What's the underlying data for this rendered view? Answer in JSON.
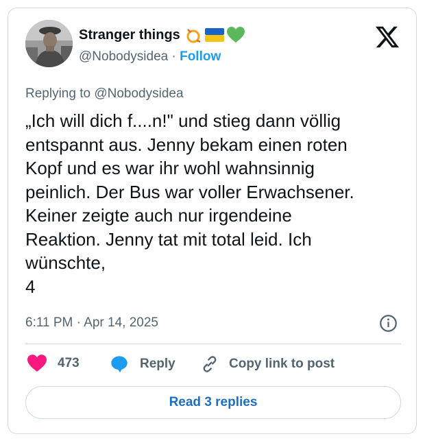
{
  "author": {
    "display_name": "Stranger things",
    "handle": "@Nobodysidea",
    "separator": "·",
    "follow_label": "Follow",
    "emoji_icons": [
      "circus-hoop-icon",
      "ukraine-flag-icon",
      "green-heart-icon"
    ]
  },
  "reply_context": {
    "prefix": "Replying to",
    "mention": "@Nobodysidea"
  },
  "tweet": {
    "text": "„Ich will dich f....n!\" und stieg dann völlig\nentspannt aus. Jenny bekam einen roten\nKopf und es war ihr wohl wahnsinnig\npeinlich. Der Bus war voller Erwachsener.\nKeiner zeigte auch nur irgendeine\nReaktion. Jenny tat mit total leid. Ich\nwünschte,\n4",
    "timestamp": "6:11 PM · Apr 14, 2025"
  },
  "actions": {
    "like_count": "473",
    "reply_label": "Reply",
    "copy_link_label": "Copy link to post"
  },
  "read_replies_label": "Read 3 replies",
  "colors": {
    "accent_blue": "#1d9bf0",
    "like_pink": "#f91880",
    "text": "#0f1419",
    "secondary_text": "#536471",
    "border": "#cfd9de"
  }
}
